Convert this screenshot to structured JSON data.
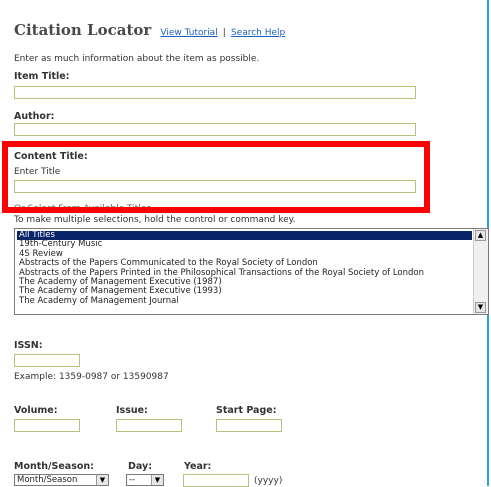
{
  "header": {
    "title": "Citation Locator",
    "view_tutorial": "View Tutorial",
    "separator": "|",
    "search_help": "Search Help"
  },
  "intro": "Enter as much information about the item as possible.",
  "item_title": {
    "label": "Item Title:"
  },
  "author": {
    "label": "Author:"
  },
  "content_title": {
    "label": "Content Title:",
    "enter_title": "Enter Title",
    "or_select": "Or Select From Available Titles",
    "multi_hint": "To make multiple selections, hold the control or command key."
  },
  "titles_list": [
    "All Titles",
    "19th-Century Music",
    "4S Review",
    "Abstracts of the Papers Communicated to the Royal Society of London",
    "Abstracts of the Papers Printed in the Philosophical Transactions of the Royal Society of London",
    "The Academy of Management Executive (1987)",
    "The Academy of Management Executive (1993)",
    "The Academy of Management Journal"
  ],
  "issn": {
    "label": "ISSN:",
    "example": "Example: 1359-0987 or 13590987"
  },
  "volume": {
    "label": "Volume:"
  },
  "issue": {
    "label": "Issue:"
  },
  "start_page": {
    "label": "Start Page:"
  },
  "month": {
    "label": "Month/Season:",
    "selected": "Month/Season"
  },
  "day": {
    "label": "Day:",
    "selected": "--"
  },
  "year": {
    "label": "Year:",
    "hint": "(yyyy)"
  },
  "colors": {
    "highlight_box": "#ff0000",
    "link": "#1f5fbf",
    "field_border": "#b9c07a"
  }
}
